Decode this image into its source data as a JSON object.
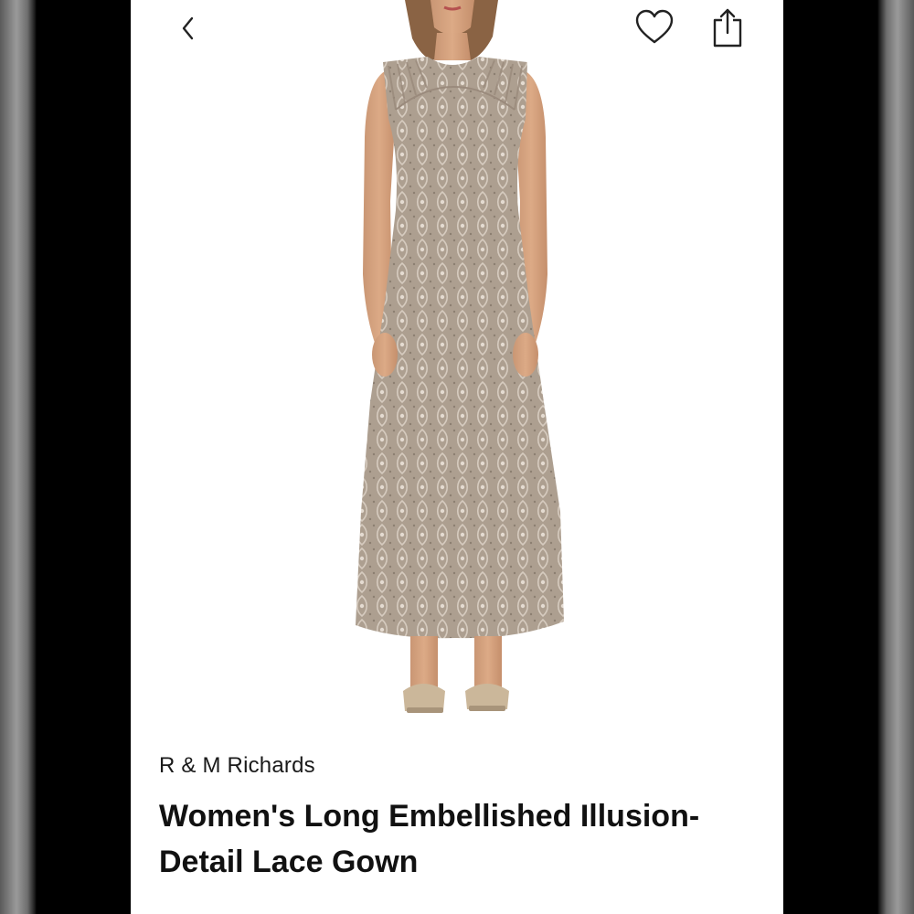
{
  "header": {
    "back_icon": "chevron-left-icon",
    "favorite_icon": "heart-outline-icon",
    "share_icon": "share-icon"
  },
  "product": {
    "image_alt": "Taupe sequined lace gown",
    "brand": "R & M Richards",
    "name": "Women's Long Embellished Illusion-Detail Lace Gown",
    "dress_color": "#b3a596"
  }
}
